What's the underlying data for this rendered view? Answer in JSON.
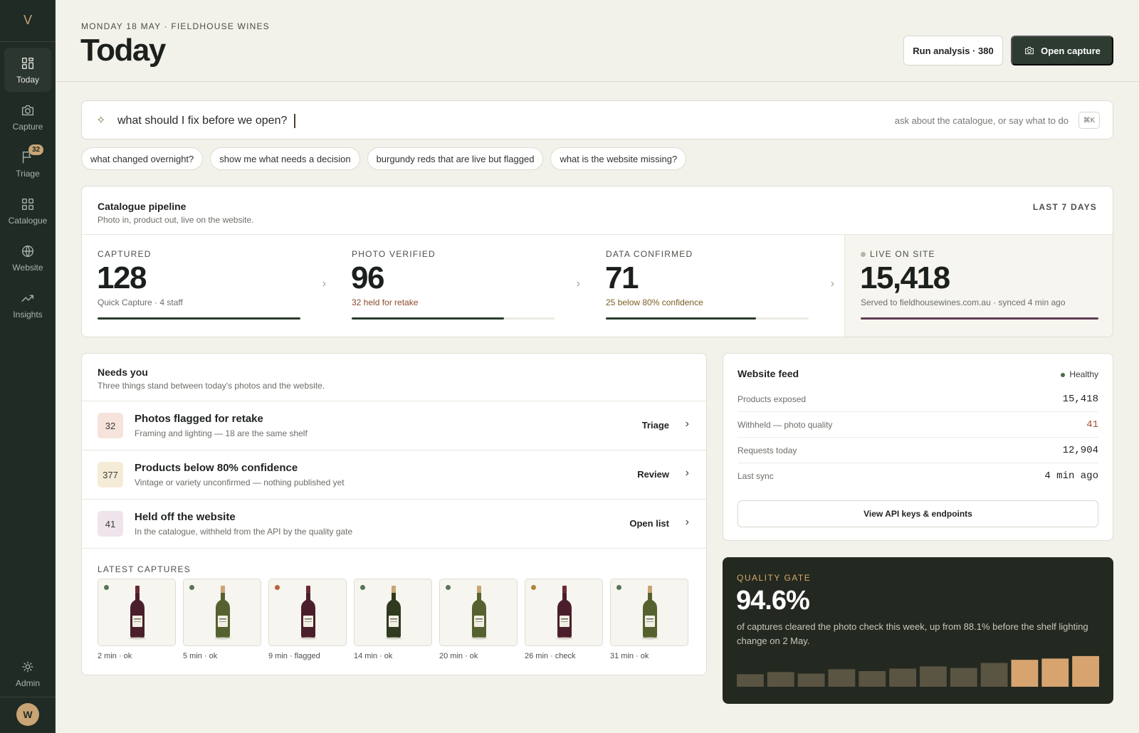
{
  "nav": {
    "logo": "V",
    "items": [
      {
        "label": "Today",
        "icon": "grid-icon"
      },
      {
        "label": "Capture",
        "icon": "camera-icon"
      },
      {
        "label": "Triage",
        "icon": "flag-icon",
        "badge": "32"
      },
      {
        "label": "Catalogue",
        "icon": "grid-icon"
      },
      {
        "label": "Website",
        "icon": "globe-icon"
      },
      {
        "label": "Insights",
        "icon": "trend-icon"
      }
    ],
    "admin_label": "Admin",
    "avatar": "W"
  },
  "header": {
    "eyebrow": "MONDAY 18 MAY · FIELDHOUSE WINES",
    "title": "Today",
    "run_analysis": "Run analysis · 380",
    "open_capture": "Open capture"
  },
  "ask": {
    "query": "what should I fix before we open?",
    "hint": "ask about the catalogue, or say what to do",
    "shortcut": "⌘K",
    "chips": [
      "what changed overnight?",
      "show me what needs a decision",
      "burgundy reds that are live but flagged",
      "what is the website missing?"
    ]
  },
  "pipeline": {
    "title": "Catalogue pipeline",
    "subtitle": "Photo in, product out, live on the website.",
    "range": "LAST 7 DAYS",
    "stages": [
      {
        "label": "CAPTURED",
        "value": "128",
        "note": "Quick Capture · 4 staff",
        "progress": 1.0
      },
      {
        "label": "PHOTO VERIFIED",
        "value": "96",
        "note": "32 held for retake",
        "progress": 0.75
      },
      {
        "label": "DATA CONFIRMED",
        "value": "71",
        "note": "25 below 80% confidence",
        "progress": 0.74
      },
      {
        "label": "LIVE ON SITE",
        "value": "15,418",
        "note": "Served to fieldhousewines.com.au · synced 4 min ago",
        "progress": 1.0
      }
    ]
  },
  "needs": {
    "title": "Needs you",
    "subtitle": "Three things stand between today's photos and the website.",
    "items": [
      {
        "count": "32",
        "title": "Photos flagged for retake",
        "sub": "Framing and lighting — 18 are the same shelf",
        "action": "Triage",
        "color": "#f6e3dc"
      },
      {
        "count": "377",
        "title": "Products below 80% confidence",
        "sub": "Vintage or variety unconfirmed — nothing published yet",
        "action": "Review",
        "color": "#f5ecd8"
      },
      {
        "count": "41",
        "title": "Held off the website",
        "sub": "In the catalogue, withheld from the API by the quality gate",
        "action": "Open list",
        "color": "#efe4ec"
      }
    ],
    "latest_label": "LATEST CAPTURES",
    "captures": [
      {
        "caption": "2 min · ok",
        "wine": "red",
        "dot": "#5a7358"
      },
      {
        "caption": "5 min · ok",
        "wine": "white",
        "dot": "#5a7358"
      },
      {
        "caption": "9 min · flagged",
        "wine": "red2",
        "dot": "#b8633a"
      },
      {
        "caption": "14 min · ok",
        "wine": "white2",
        "dot": "#5a7358"
      },
      {
        "caption": "20 min · ok",
        "wine": "white3",
        "dot": "#5a7358"
      },
      {
        "caption": "26 min · check",
        "wine": "red",
        "dot": "#b0843a"
      },
      {
        "caption": "31 min · ok",
        "wine": "white",
        "dot": "#5a7358"
      }
    ]
  },
  "feed": {
    "title": "Website feed",
    "status": "Healthy",
    "rows": [
      {
        "key": "Products exposed",
        "value": "15,418"
      },
      {
        "key": "Withheld — photo quality",
        "value": "41",
        "warn": true
      },
      {
        "key": "Requests today",
        "value": "12,904"
      },
      {
        "key": "Last sync",
        "value": "4 min ago"
      }
    ],
    "button": "View API keys & endpoints"
  },
  "quality": {
    "label": "QUALITY GATE",
    "value": "94.6%",
    "text": "of captures cleared the photo check this week, up from 88.1% before the shelf lighting change on 2 May.",
    "bars": [
      0.4,
      0.47,
      0.42,
      0.56,
      0.5,
      0.58,
      0.65,
      0.6,
      0.76,
      0.86,
      0.9,
      0.98
    ],
    "highlight_from": 9,
    "colors": {
      "muted": "#5a5442",
      "highlight": "#d7a470"
    }
  }
}
